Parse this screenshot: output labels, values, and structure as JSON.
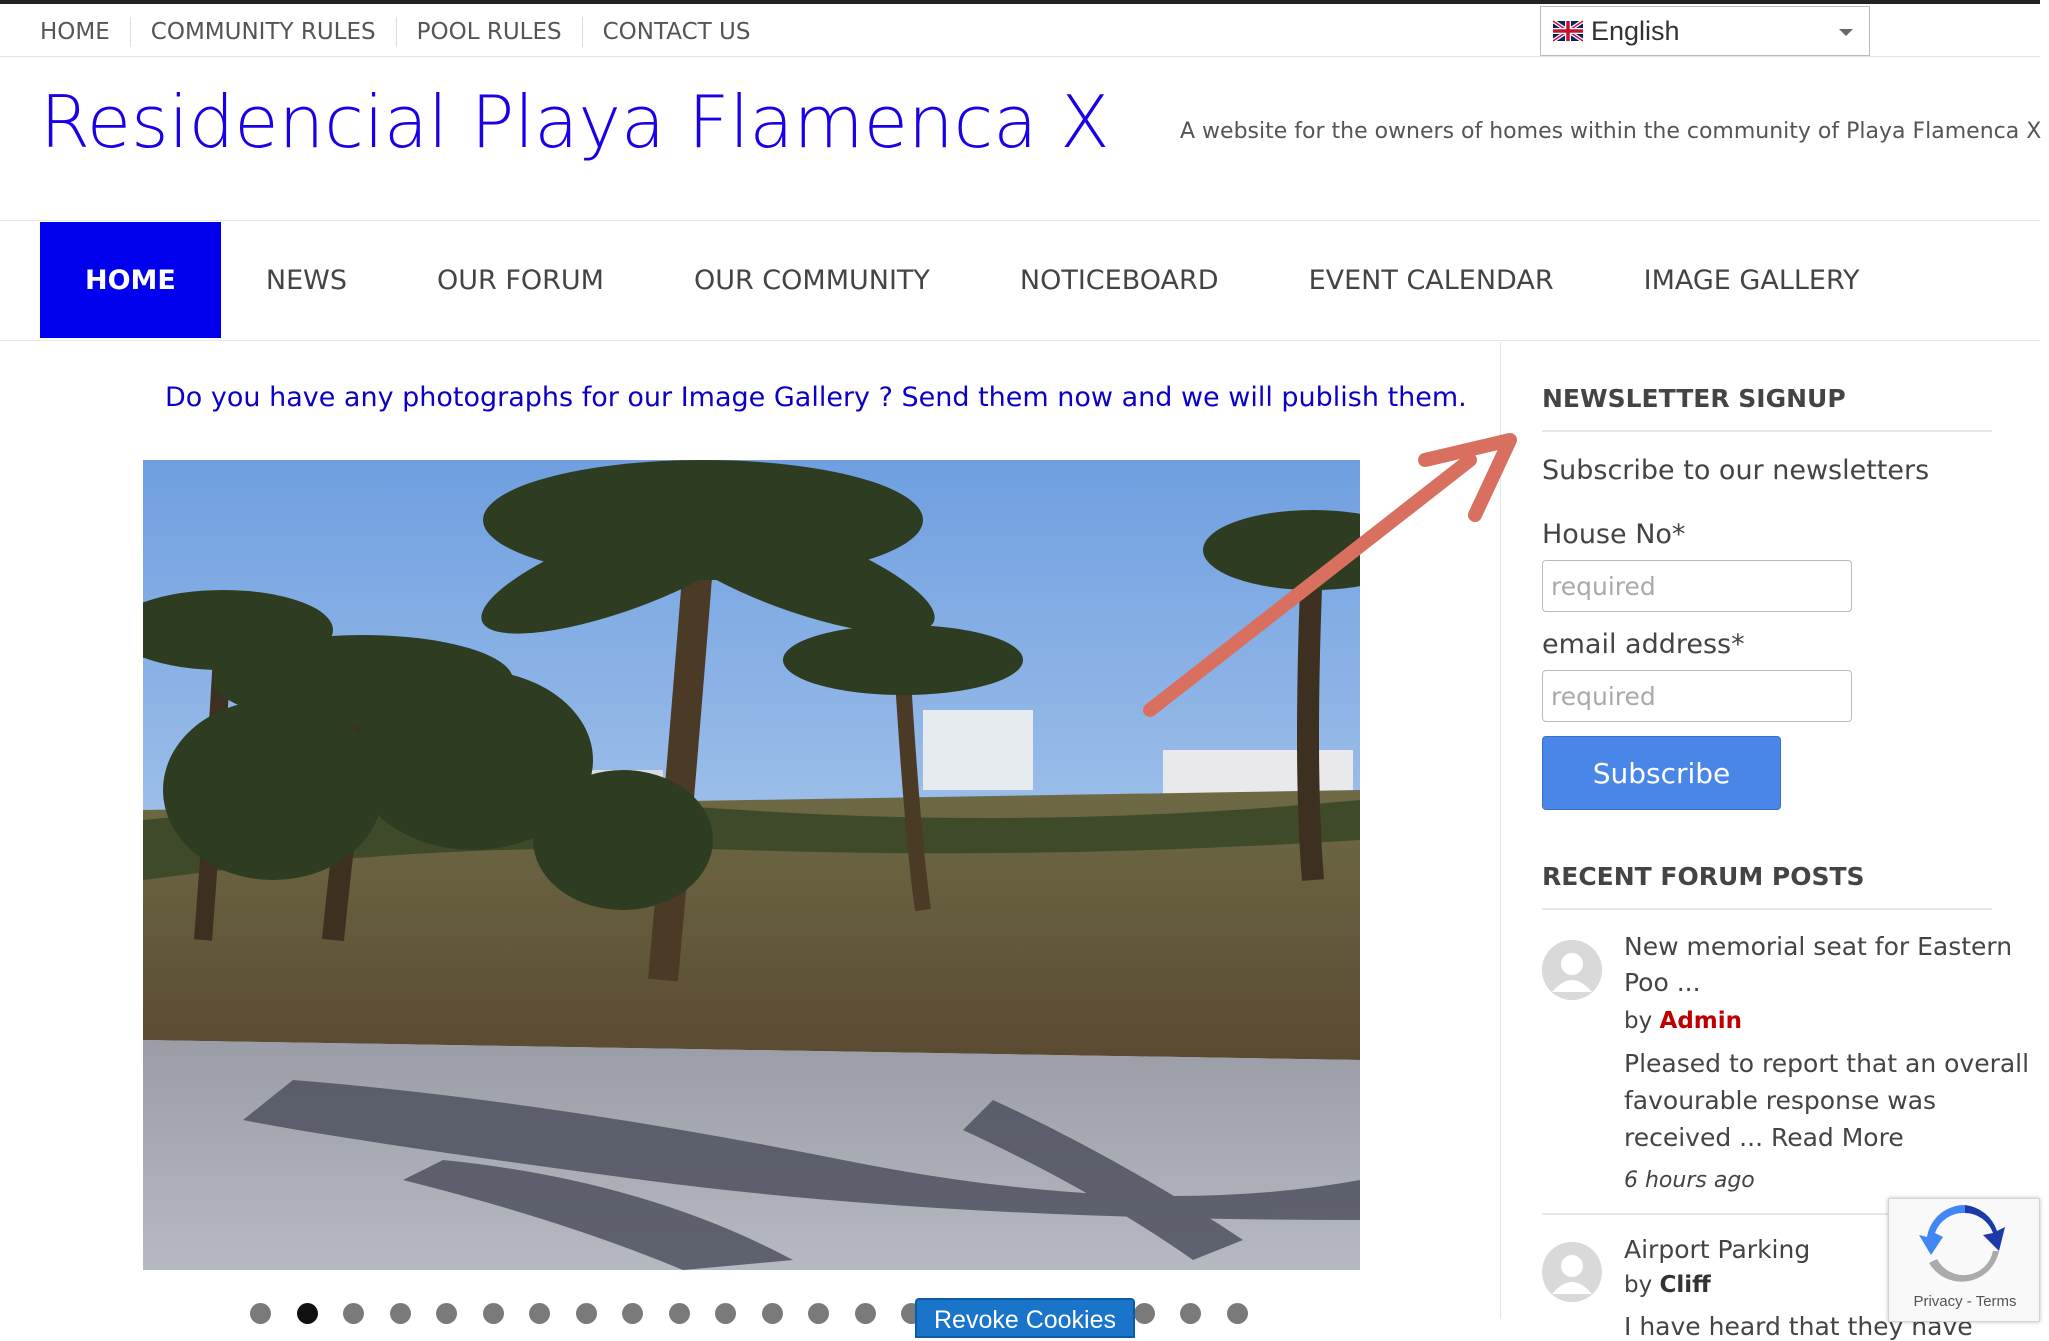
{
  "topnav": {
    "items": [
      "HOME",
      "COMMUNITY RULES",
      "POOL RULES",
      "CONTACT US"
    ]
  },
  "language": {
    "selected": "English",
    "flag_icon": "uk-flag-icon"
  },
  "header": {
    "site_title": "Residencial Playa Flamenca X",
    "tagline": "A website for the owners of homes within the community of Playa Flamenca X",
    "title_color": "#1a00e6"
  },
  "mainnav": {
    "items": [
      "HOME",
      "NEWS",
      "OUR FORUM",
      "OUR COMMUNITY",
      "NOTICEBOARD",
      "EVENT CALENDAR",
      "IMAGE GALLERY"
    ],
    "active_index": 0,
    "active_color": "#0000ee"
  },
  "content": {
    "promo": "Do you have any photographs for our Image Gallery ? Send them now and we will publish them.",
    "slider": {
      "dot_count": 22,
      "active_dot": 2
    },
    "revoke_cookies": "Revoke Cookies"
  },
  "sidebar": {
    "newsletter": {
      "title": "NEWSLETTER SIGNUP",
      "subtitle": "Subscribe to our newsletters",
      "house_label": "House No*",
      "house_placeholder": "required",
      "email_label": "email address*",
      "email_placeholder": "required",
      "button": "Subscribe",
      "button_color": "#4a86e8"
    },
    "forum": {
      "title": "RECENT FORUM POSTS",
      "posts": [
        {
          "title_line1": "New memorial seat for Eastern",
          "title_line2": "Poo ...",
          "by": "by",
          "author": "Admin",
          "excerpt_line1": "Pleased to report that an overall",
          "excerpt_line2": "favourable response was",
          "excerpt_line3": "received ... Read More",
          "time": "6 hours ago"
        },
        {
          "title_line1": "Airport Parking",
          "by": "by",
          "author": "Cliff",
          "excerpt_line1": "I have heard that they have"
        }
      ]
    }
  },
  "recaptcha": {
    "privacy": "Privacy",
    "separator": " - ",
    "terms": "Terms"
  }
}
